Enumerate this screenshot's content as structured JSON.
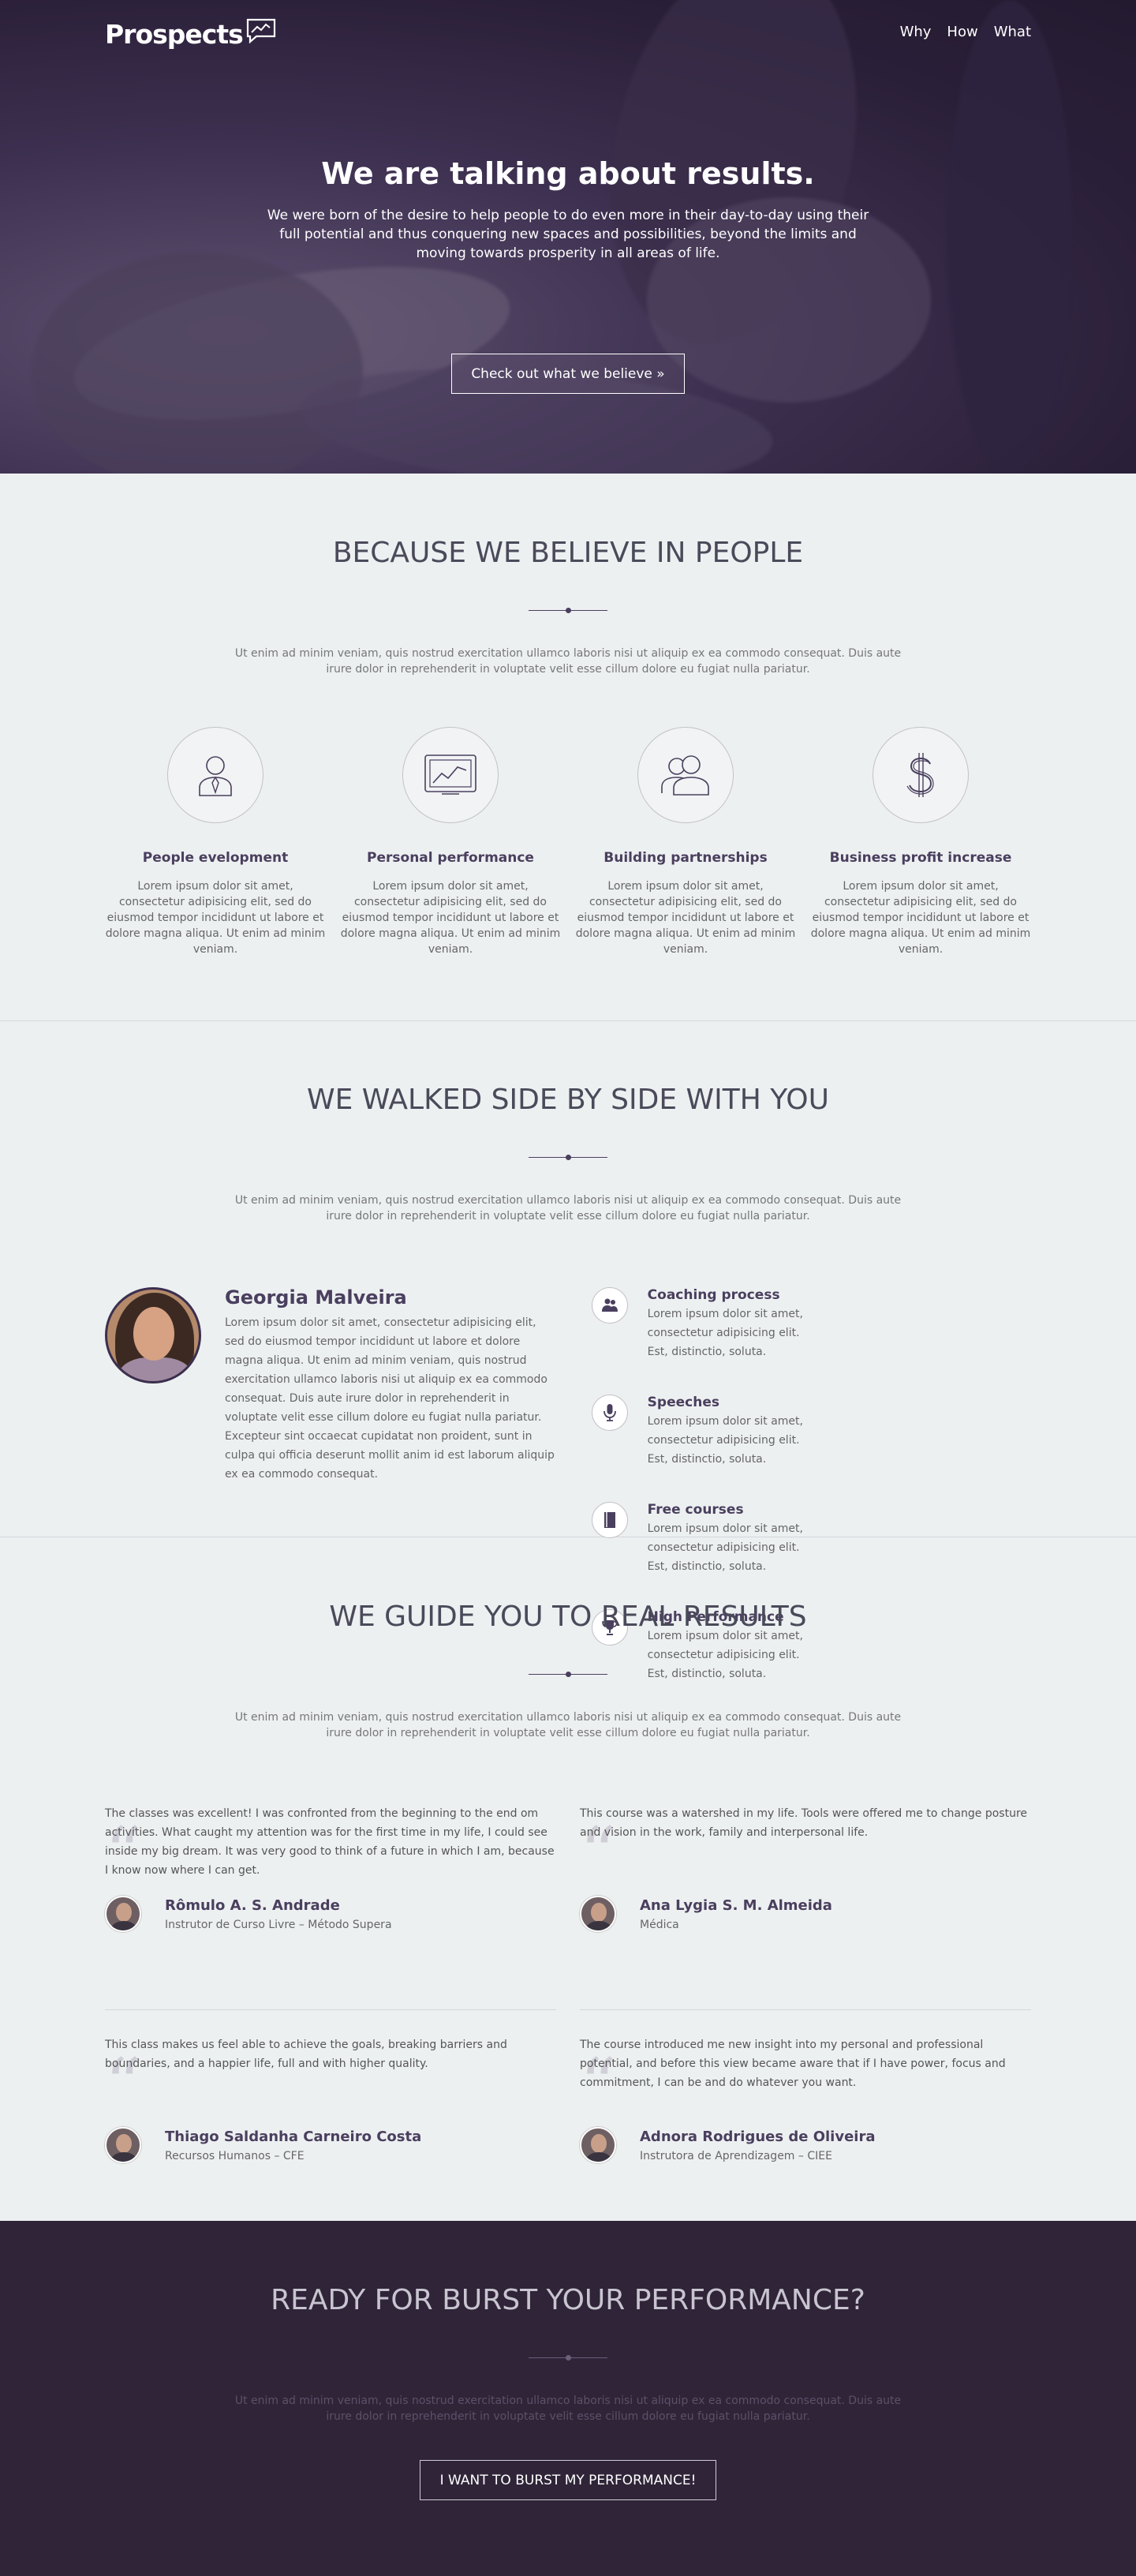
{
  "nav": {
    "logo": "Prospects",
    "items": [
      "Why",
      "How",
      "What"
    ]
  },
  "hero": {
    "title": "We are talking about results.",
    "text": "We were born of the desire to help people to do even more in their day-to-day using their full potential and thus conquering new spaces and possibilities, beyond the limits and moving towards prosperity in all areas of life.",
    "button": "Check out what we believe »"
  },
  "people": {
    "title": "BECAUSE WE BELIEVE IN PEOPLE",
    "intro": "Ut enim ad minim veniam, quis nostrud exercitation ullamco laboris nisi ut aliquip ex ea commodo consequat. Duis aute irure dolor in reprehenderit in voluptate velit esse cillum dolore eu fugiat nulla pariatur.",
    "features": [
      {
        "icon": "person-icon",
        "title": "People evelopment",
        "text": "Lorem ipsum dolor sit amet, consectetur adipisicing elit, sed do eiusmod tempor incididunt ut labore et dolore magna aliqua. Ut enim ad minim veniam."
      },
      {
        "icon": "chart-icon",
        "title": "Personal performance",
        "text": "Lorem ipsum dolor sit amet, consectetur adipisicing elit, sed do eiusmod tempor incididunt ut labore et dolore magna aliqua. Ut enim ad minim veniam."
      },
      {
        "icon": "users-icon",
        "title": "Building partnerships",
        "text": "Lorem ipsum dolor sit amet, consectetur adipisicing elit, sed do eiusmod tempor incididunt ut labore et dolore magna aliqua. Ut enim ad minim veniam."
      },
      {
        "icon": "dollar-icon",
        "title": "Business profit increase",
        "text": "Lorem ipsum dolor sit amet, consectetur adipisicing elit, sed do eiusmod tempor incididunt ut labore et dolore magna aliqua. Ut enim ad minim veniam."
      }
    ]
  },
  "side": {
    "title": "WE WALKED SIDE BY SIDE WITH YOU",
    "intro": "Ut enim ad minim veniam, quis nostrud exercitation ullamco laboris nisi ut aliquip ex ea commodo consequat. Duis aute irure dolor in reprehenderit in voluptate velit esse cillum dolore eu fugiat nulla pariatur.",
    "profile": {
      "name": "Georgia Malveira",
      "bio": "Lorem ipsum dolor sit amet, consectetur adipisicing elit, sed do eiusmod tempor incididunt ut labore et dolore magna aliqua. Ut enim ad minim veniam, quis nostrud exercitation ullamco laboris nisi ut aliquip ex ea commodo consequat. Duis aute irure dolor in reprehenderit in voluptate velit esse cillum dolore eu fugiat nulla pariatur. Excepteur sint occaecat cupidatat non proident, sunt in culpa qui officia deserunt mollit anim id est laborum aliquip ex ea commodo consequat."
    },
    "services": [
      {
        "icon": "coaching-icon",
        "title": "Coaching process",
        "text": "Lorem ipsum dolor sit amet, consectetur adipisicing elit. Est, distinctio, soluta."
      },
      {
        "icon": "microphone-icon",
        "title": "Speeches",
        "text": "Lorem ipsum dolor sit amet, consectetur adipisicing elit. Est, distinctio, soluta."
      },
      {
        "icon": "book-icon",
        "title": "Free courses",
        "text": "Lorem ipsum dolor sit amet, consectetur adipisicing elit. Est, distinctio, soluta."
      },
      {
        "icon": "trophy-icon",
        "title": "High Performance",
        "text": "Lorem ipsum dolor sit amet, consectetur adipisicing elit. Est, distinctio, soluta."
      }
    ]
  },
  "guide": {
    "title": "WE GUIDE YOU TO REAL RESULTS",
    "intro": "Ut enim ad minim veniam, quis nostrud exercitation ullamco laboris nisi ut aliquip ex ea commodo consequat. Duis aute irure dolor in reprehenderit in voluptate velit esse cillum dolore eu fugiat nulla pariatur.",
    "testimonials": [
      {
        "quote": "The classes was excellent! I was confronted from the beginning to the end om activities. What caught my attention was for the first time in my life, I could see inside my big dream. It was very good to think of a future in which I am, because I know now where I can get.",
        "name": "Rômulo A. S. Andrade",
        "role": "Instrutor de Curso Livre – Método Supera"
      },
      {
        "quote": "This course was a watershed in my life. Tools were offered me to change posture and vision in the work, family and interpersonal life.",
        "name": "Ana Lygia S. M. Almeida",
        "role": "Médica"
      },
      {
        "quote": "This class makes us feel able to achieve the goals, breaking barriers and boundaries, and a happier life, full and with higher quality.",
        "name": "Thiago Saldanha Carneiro Costa",
        "role": "Recursos Humanos – CFE"
      },
      {
        "quote": "The course introduced me new insight into my personal and professional potential, and before this view became aware that if I have power, focus and commitment, I can be and do whatever you want.",
        "name": "Adnora Rodrigues de Oliveira",
        "role": "Instrutora de Aprendizagem – CIEE"
      }
    ]
  },
  "cta": {
    "title": "READY FOR BURST YOUR PERFORMANCE?",
    "intro": "Ut enim ad minim veniam, quis nostrud exercitation ullamco laboris nisi ut aliquip ex ea commodo consequat. Duis aute irure dolor in reprehenderit in voluptate velit esse cillum dolore eu fugiat nulla pariatur.",
    "button": "I WANT TO BURST MY PERFORMANCE!"
  },
  "colors": {
    "brand_dark": "#2f2438",
    "accent": "#4a3f5e",
    "background": "#edf0f1"
  }
}
